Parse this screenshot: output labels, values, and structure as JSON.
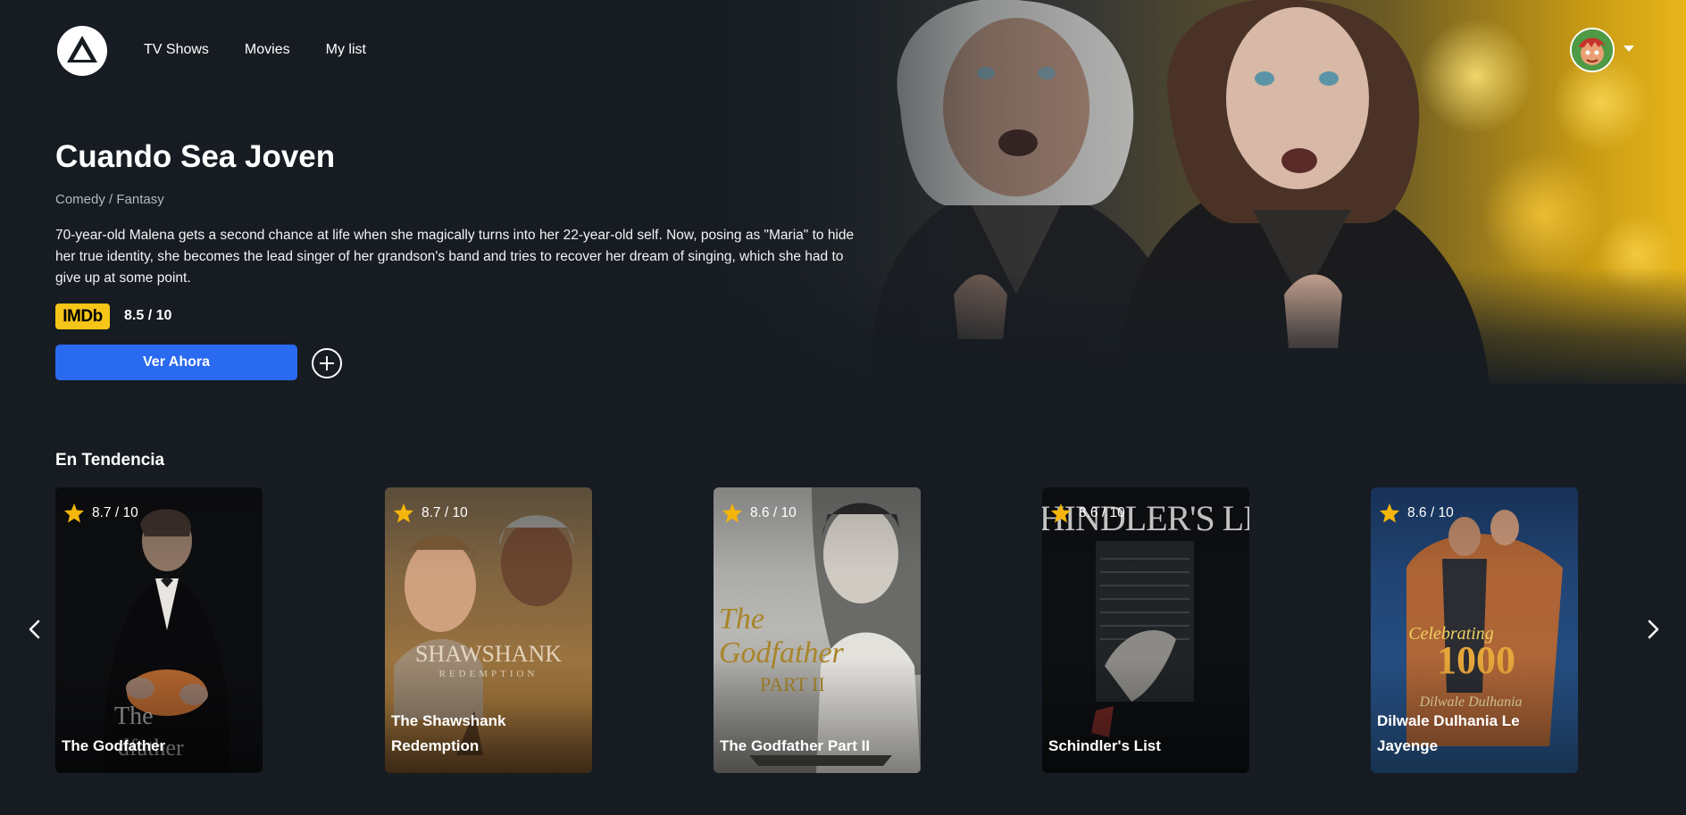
{
  "nav": {
    "items": [
      "TV Shows",
      "Movies",
      "My list"
    ]
  },
  "hero": {
    "title": "Cuando Sea Joven",
    "genre": "Comedy / Fantasy",
    "description": "70-year-old Malena gets a second chance at life when she magically turns into her 22-year-old self. Now, posing as \"Maria\" to hide her true identity, she becomes the lead singer of her grandson's band and tries to recover her dream of singing, which she had to give up at some point.",
    "imdb_label": "IMDb",
    "rating": "8.5 / 10",
    "watch_label": "Ver Ahora"
  },
  "trending": {
    "title": "En Tendencia",
    "movies": [
      {
        "title": "The Godfather",
        "rating": "8.7 / 10"
      },
      {
        "title": "The Shawshank Redemption",
        "rating": "8.7 / 10"
      },
      {
        "title": "The Godfather Part II",
        "rating": "8.6 / 10"
      },
      {
        "title": "Schindler's List",
        "rating": "8.6 / 10"
      },
      {
        "title": "Dilwale Dulhania Le Jayenge",
        "rating": "8.6 / 10"
      }
    ]
  },
  "colors": {
    "background": "#161c22",
    "accent": "#2a6af0",
    "imdb": "#f5c518",
    "star": "#f5b50a"
  },
  "icons": {
    "logo": "triangle-logo-icon",
    "add": "plus-circle-icon",
    "caret": "caret-down-icon",
    "star": "star-icon",
    "prev": "chevron-left-icon",
    "next": "chevron-right-icon"
  }
}
